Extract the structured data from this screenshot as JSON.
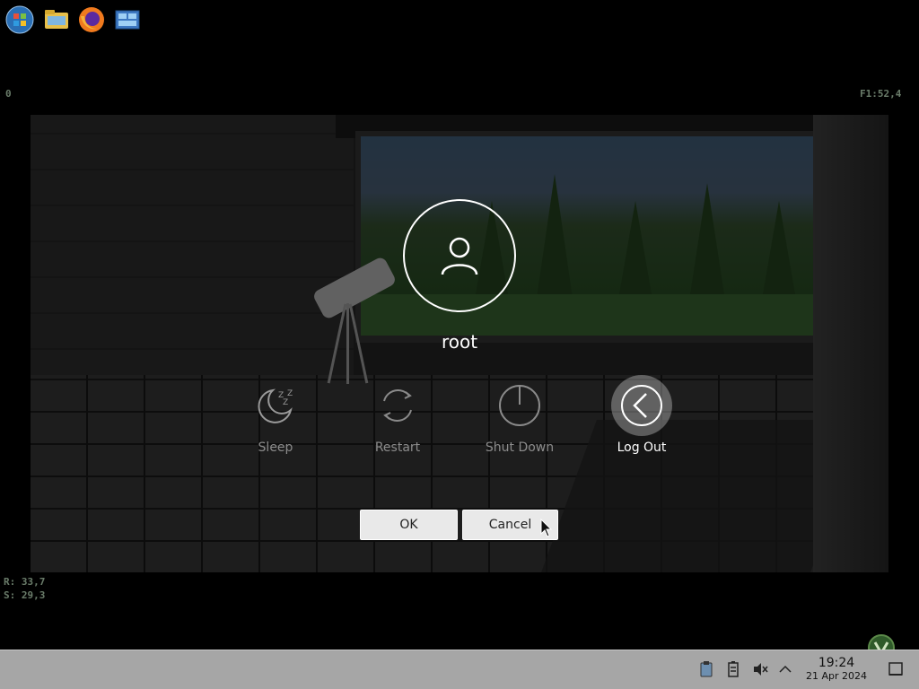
{
  "hud": {
    "top_left": "0",
    "top_right": "F1:52,4",
    "bottom_left_1": "R: 33,7",
    "bottom_left_2": "S: 29,3"
  },
  "dialog": {
    "username": "root",
    "actions": [
      {
        "label": "Sleep",
        "icon": "sleep-icon",
        "active": false
      },
      {
        "label": "Restart",
        "icon": "restart-icon",
        "active": false
      },
      {
        "label": "Shut Down",
        "icon": "shutdown-icon",
        "active": false
      },
      {
        "label": "Log Out",
        "icon": "logout-icon",
        "active": true
      }
    ],
    "ok_label": "OK",
    "cancel_label": "Cancel"
  },
  "taskbar": {
    "apps": [
      "start-menu-icon",
      "file-manager-icon",
      "firefox-icon",
      "system-settings-icon"
    ],
    "tray": [
      "clipboard-icon",
      "battery-icon",
      "volume-muted-icon",
      "expand-tray-icon"
    ],
    "time": "19:24",
    "date": "21 Apr 2024"
  },
  "colors": {
    "dialog_text": "#ffffff",
    "inactive_label": "#8c8c8c",
    "taskbar": "#a6a6a6"
  }
}
